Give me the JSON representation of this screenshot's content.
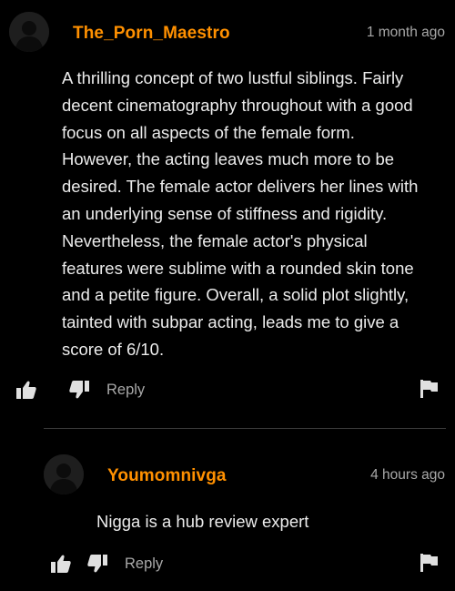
{
  "comments": [
    {
      "username": "The_Porn_Maestro",
      "timestamp": "1 month ago",
      "lines": [
        "A thrilling concept of two lustful siblings. Fairly",
        "decent cinematography throughout with a good",
        "focus on all aspects of the female form.",
        "However, the acting leaves much more to be",
        "desired. The female actor delivers her lines with",
        "an underlying sense of stiffness and rigidity.",
        "Nevertheless, the female actor's physical",
        "features were sublime with a rounded skin tone",
        "and a petite figure. Overall, a solid plot slightly,",
        "tainted with subpar acting, leads me to give a",
        "score of 6/10."
      ],
      "reply_label": "Reply"
    },
    {
      "username": "Youmomnivga",
      "timestamp": "4 hours ago",
      "lines": [
        "Nigga is a hub review expert"
      ],
      "reply_label": "Reply"
    }
  ],
  "icons": {
    "avatar": "default-avatar-icon",
    "like": "thumbs-up-icon",
    "dislike": "thumbs-down-icon",
    "flag": "flag-icon"
  },
  "colors": {
    "background": "#000000",
    "username": "#ff9000",
    "body_text": "#ececec",
    "meta_text": "#a8a8a8",
    "icon": "#e0e0e0",
    "divider": "#3a3a3a"
  }
}
